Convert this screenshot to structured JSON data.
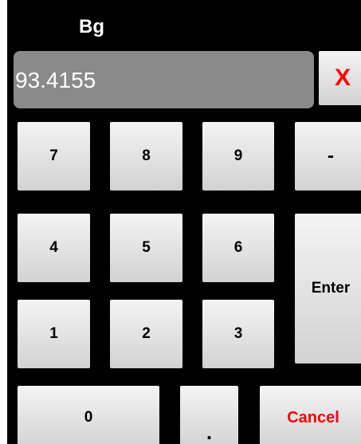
{
  "title": "Bg",
  "display": {
    "value": "93.4155"
  },
  "keys": {
    "clear": "X",
    "seven": "7",
    "eight": "8",
    "nine": "9",
    "minus": "-",
    "four": "4",
    "five": "5",
    "six": "6",
    "enter": "Enter",
    "one": "1",
    "two": "2",
    "three": "3",
    "zero": "0",
    "dot": ".",
    "cancel": "Cancel"
  },
  "colors": {
    "background": "#000000",
    "display_background": "#8a8a8a",
    "key_background": "#e6e6e6",
    "accent_red": "#ff0000"
  }
}
